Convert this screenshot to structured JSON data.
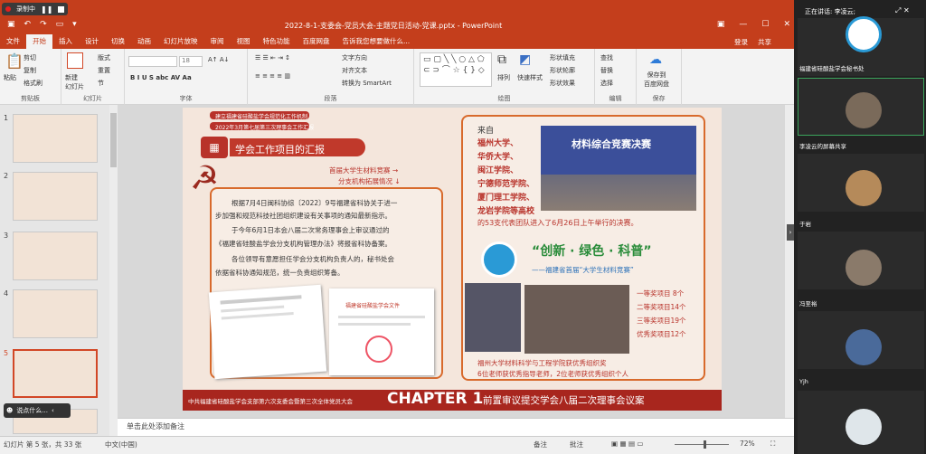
{
  "recorder": {
    "label": "录制中"
  },
  "window": {
    "title": "2022-8-1-支委会-党员大会-主题党日活动-党课.pptx - PowerPoint"
  },
  "ribbon_tabs": [
    "文件",
    "开始",
    "插入",
    "设计",
    "切换",
    "动画",
    "幻灯片放映",
    "审阅",
    "视图",
    "特色功能",
    "百度网盘",
    "告诉我您想要做什么..."
  ],
  "account": {
    "login": "登录",
    "share": "共享"
  },
  "clipboard": {
    "paste": "粘贴",
    "cut": "剪切",
    "copy": "复制",
    "format": "格式刷",
    "label": "剪贴板"
  },
  "slides_group": {
    "new": "新建\n幻灯片",
    "layout": "版式",
    "reset": "重置",
    "section": "节",
    "label": "幻灯片"
  },
  "font_group": {
    "size": "18",
    "label": "字体"
  },
  "paragraph_group": {
    "text_dir": "文字方向",
    "align": "对齐文本",
    "smartart": "转换为 SmartArt",
    "label": "段落"
  },
  "drawing_group": {
    "arrange": "排列",
    "quick": "快速样式",
    "fill": "形状填充",
    "outline": "形状轮廓",
    "effect": "形状效果",
    "label": "绘图"
  },
  "editing_group": {
    "find": "查找",
    "replace": "替换",
    "select": "选择",
    "label": "编辑"
  },
  "save_group": {
    "save": "保存到\n百度网盘",
    "label": "保存"
  },
  "thumbnails": [
    "1",
    "2",
    "3",
    "4",
    "5",
    "6"
  ],
  "slide": {
    "header_small_1": "建立福建省硅酸盐学会规范化工作机制",
    "header_small_2": "2022年3月第七届第三次理事会工作汇报",
    "section_title": "学会工作项目的汇报",
    "arrow_1": "首届大学生材料竞赛 →",
    "arrow_2": "分支机构拓展情况 ↓",
    "para_1": "根据7月4日闽科协综〔2022〕9号福建省科协关于进一",
    "para_2": "步加强和规范科技社团组织建设有关事项的通知最新指示。",
    "para_3": "于今年6月1日本会八届二次常务理事会上审议通过的",
    "para_4": "《福建省硅酸盐学会分支机构管理办法》将报省科协备案。",
    "para_5": "各位领导有意愿担任学会分支机构负责人的，秘书处会",
    "para_6": "依据省科协通知规范，统一负责组织筹备。",
    "from": "来自",
    "schools": [
      "福州大学、",
      "华侨大学、",
      "闽江学院、",
      "宁德师范学院、",
      "厦门理工学院、",
      "龙岩学院等高校"
    ],
    "teams": "的53支代表团队进入了6月26日上午举行的决赛。",
    "photo_banner": "材料综合竞赛决赛",
    "slogan": "“创新 · 绿色 · 科普”",
    "subslogan": "——福建省首届“大学生材料竞赛”",
    "awards": [
      "一等奖项目 8个",
      "二等奖项目14个",
      "三等奖项目19个",
      "优秀奖项目12个"
    ],
    "org_1": "福州大学材料科学与工程学院获优秀组织奖",
    "org_2": "6位老师获优秀指导老师，2位老师获优秀组织个人",
    "footer_left": "中共福建省硅酸盐学会支部第六次支委会暨第三次全体党员大会",
    "chapter": "CHAPTER 1",
    "footer_right": "前置审议提交学会八届二次理事会议案",
    "doc_title": "福建省硅酸盐学会文件"
  },
  "notes": {
    "placeholder": "单击此处添加备注"
  },
  "status": {
    "slide": "幻灯片 第 5 张，共 33 张",
    "lang": "中文(中国)",
    "notes": "备注",
    "comments": "批注",
    "zoom": "72%"
  },
  "ime": {
    "label": "说点什么..."
  },
  "meeting": {
    "speaking": "正在讲话: 李凌云;",
    "participants": [
      "福建省硅酸盐学会秘书处",
      "李凌云的屏幕共享",
      "于岩",
      "冯至裕",
      "Yjh",
      ""
    ]
  }
}
